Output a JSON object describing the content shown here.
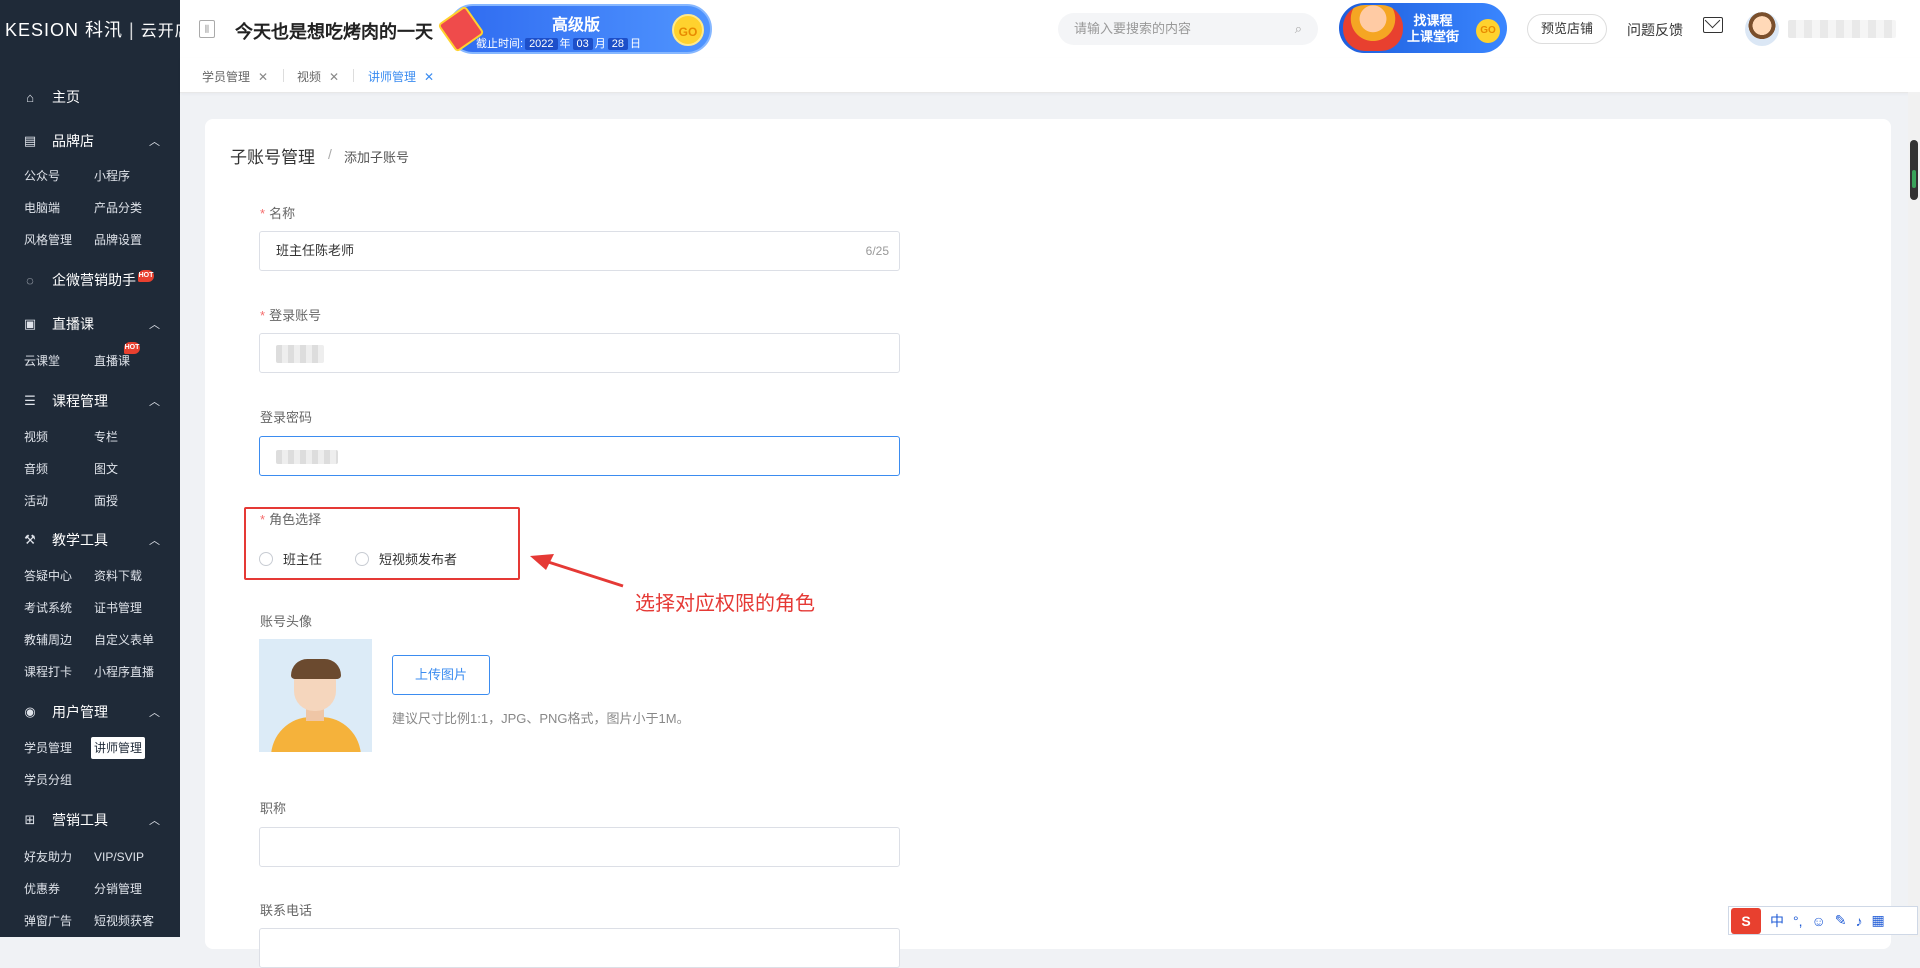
{
  "sidebar": {
    "logo_brand": "KESION 科汛",
    "logo_sub": "云开店",
    "hot_badge": "HOT",
    "home": "主页",
    "groups": {
      "brand": {
        "label": "品牌店",
        "items": [
          "公众号",
          "小程序",
          "电脑端",
          "产品分类",
          "风格管理",
          "品牌设置"
        ]
      },
      "wecom": {
        "label": "企微营销助手"
      },
      "live": {
        "label": "直播课",
        "items": [
          "云课堂",
          "直播课"
        ]
      },
      "course": {
        "label": "课程管理",
        "items": [
          "视频",
          "专栏",
          "音频",
          "图文",
          "活动",
          "面授"
        ]
      },
      "teach": {
        "label": "教学工具",
        "items": [
          "答疑中心",
          "资料下载",
          "考试系统",
          "证书管理",
          "教辅周边",
          "自定义表单",
          "课程打卡",
          "小程序直播"
        ]
      },
      "user": {
        "label": "用户管理",
        "items": [
          "学员管理",
          "讲师管理",
          "学员分组"
        ]
      },
      "marketing": {
        "label": "营销工具",
        "items": [
          "好友助力",
          "VIP/SVIP",
          "优惠券",
          "分销管理",
          "弹窗广告",
          "短视频获客"
        ]
      }
    }
  },
  "header": {
    "title": "今天也是想吃烤肉的一天",
    "banner_title": "高级版",
    "banner_deadline_label": "截止时间:",
    "banner_year": "2022",
    "banner_year_unit": "年",
    "banner_month": "03",
    "banner_month_unit": "月",
    "banner_day": "28",
    "banner_day_unit": "日",
    "banner_go": "GO",
    "search_placeholder": "请输入要搜索的内容",
    "promo_line1": "找课程",
    "promo_line2": "上课堂街",
    "promo_go": "GO",
    "preview_store": "预览店铺",
    "feedback": "问题反馈"
  },
  "tabs": [
    {
      "label": "学员管理",
      "active": false
    },
    {
      "label": "视频",
      "active": false
    },
    {
      "label": "讲师管理",
      "active": true
    }
  ],
  "tab_close": "✕",
  "breadcrumb": {
    "main": "子账号管理",
    "sep": "/",
    "sub": "添加子账号"
  },
  "form": {
    "name_label": "名称",
    "name_value": "班主任陈老师",
    "name_count": "6/25",
    "account_label": "登录账号",
    "password_label": "登录密码",
    "role_label": "角色选择",
    "roles": [
      "班主任",
      "短视频发布者"
    ],
    "avatar_label": "账号头像",
    "upload_button": "上传图片",
    "upload_hint": "建议尺寸比例1:1，JPG、PNG格式，图片小于1M。",
    "title_label": "职称",
    "phone_label": "联系电话",
    "required_mark": "*"
  },
  "annotation": {
    "text": "选择对应权限的角色",
    "color": "#e53935"
  },
  "ime": {
    "logo": "S",
    "lang": "中",
    "punct": "°,"
  },
  "colors": {
    "sidebar_bg": "#1f2a38",
    "accent": "#3b8cf0",
    "required": "#f56c6c"
  }
}
